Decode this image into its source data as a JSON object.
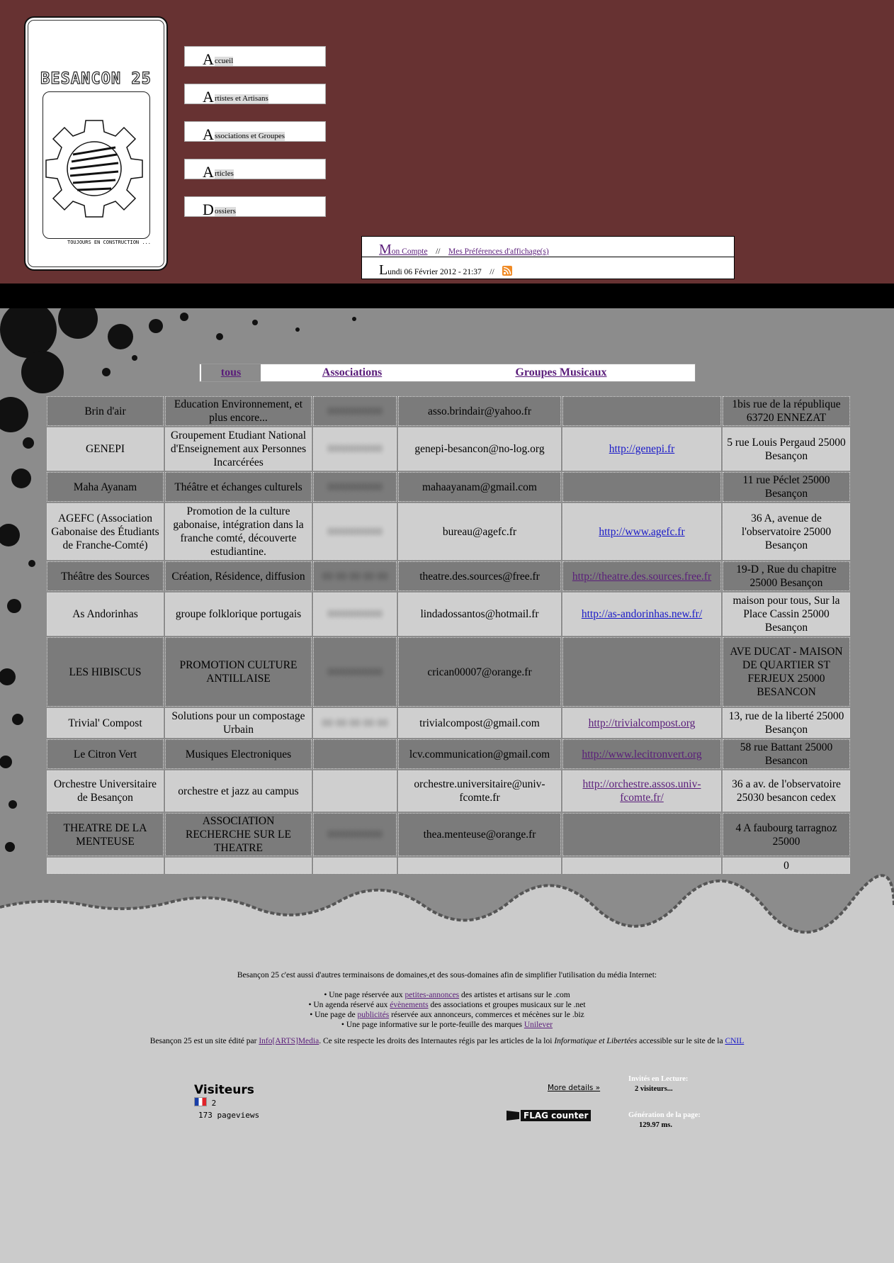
{
  "site": {
    "logo_title": "BESANCON 25",
    "logo_caption": "TOUJOURS EN CONSTRUCTION ..."
  },
  "menu": [
    {
      "initial": "A",
      "rest": "ccueil"
    },
    {
      "initial": "A",
      "rest": "rtistes et Artisans"
    },
    {
      "initial": "A",
      "rest": "ssociations et Groupes"
    },
    {
      "initial": "A",
      "rest": "rticles"
    },
    {
      "initial": "D",
      "rest": "ossiers"
    }
  ],
  "account": {
    "initial": "M",
    "rest": "on Compte",
    "sep": "//",
    "prefs": "Mes Préférences d'affichage(s)"
  },
  "date": {
    "initial": "L",
    "rest": "undi 06 Février 2012 - 21:37",
    "sep": "//"
  },
  "tabs": {
    "all": "tous",
    "assoc": "Associations",
    "music": "Groupes Musicaux"
  },
  "rows": [
    {
      "name": "Brin d'air",
      "desc": "Education Environnement, et plus encore...",
      "phone": "0000000000",
      "email": "asso.brindair@yahoo.fr",
      "site": "",
      "blue": false,
      "addr": "1bis rue de la république 63720 ENNEZAT"
    },
    {
      "name": "GENEPI",
      "desc": "Groupement Etudiant National d'Enseignement aux Personnes Incarcérées",
      "phone": "0000000000",
      "email": "genepi-besancon@no-log.org",
      "site": "http://genepi.fr",
      "blue": true,
      "addr": "5 rue Louis Pergaud 25000 Besançon"
    },
    {
      "name": "Maha Ayanam",
      "desc": "Théâtre et échanges culturels",
      "phone": "0000000000",
      "email": "mahaayanam@gmail.com",
      "site": "",
      "blue": false,
      "addr": "11 rue Péclet 25000 Besançon"
    },
    {
      "name": "AGEFC (Association Gabonaise des Étudiants de Franche-Comté)",
      "desc": "Promotion de la culture gabonaise, intégration dans la franche comté, découverte estudiantine.",
      "phone": "0000000000",
      "email": "bureau@agefc.fr",
      "site": "http://www.agefc.fr",
      "blue": true,
      "addr": "36 A, avenue de l'observatoire 25000 Besançon"
    },
    {
      "name": "Théâtre des Sources",
      "desc": "Création, Résidence, diffusion",
      "phone": "00 00 00 00 00",
      "email": "theatre.des.sources@free.fr",
      "site": "http://theatre.des.sources.free.fr",
      "blue": false,
      "addr": "19-D , Rue du chapitre 25000 Besançon"
    },
    {
      "name": "As Andorinhas",
      "desc": "groupe folklorique portugais",
      "phone": "0000000000",
      "email": "lindadossantos@hotmail.fr",
      "site": "http://as-andorinhas.new.fr/",
      "blue": true,
      "addr": "maison pour tous, Sur la Place Cassin 25000 Besançon"
    },
    {
      "name": "LES HIBISCUS",
      "desc": "PROMOTION CULTURE ANTILLAISE",
      "phone": "0000000000",
      "email": "crican00007@orange.fr",
      "site": "",
      "blue": false,
      "addr": "AVE DUCAT - MAISON DE QUARTIER ST FERJEUX 25000 BESANCON"
    },
    {
      "name": "Trivial' Compost",
      "desc": "Solutions pour un compostage Urbain",
      "phone": "00 00 00 00 00",
      "email": "trivialcompost@gmail.com",
      "site": "http://trivialcompost.org",
      "blue": false,
      "addr": "13, rue de la liberté 25000 Besançon"
    },
    {
      "name": "Le Citron Vert",
      "desc": "Musiques Electroniques",
      "phone": "",
      "email": "lcv.communication@gmail.com",
      "site": "http://www.lecitronvert.org",
      "blue": false,
      "addr": "58 rue Battant 25000 Besancon"
    },
    {
      "name": "Orchestre Universitaire de Besançon",
      "desc": "orchestre et jazz au campus",
      "phone": "",
      "email": "orchestre.universitaire@univ-fcomte.fr",
      "site": "http://orchestre.assos.univ-fcomte.fr/",
      "blue": false,
      "addr": "36 a av. de l'observatoire 25030 besancon cedex"
    },
    {
      "name": "THEATRE DE LA MENTEUSE",
      "desc": "ASSOCIATION RECHERCHE SUR LE THEATRE",
      "phone": "0000000000",
      "email": "thea.menteuse@orange.fr",
      "site": "",
      "blue": false,
      "addr": "4 A faubourg tarragnoz 25000"
    },
    {
      "name": "",
      "desc": "",
      "phone": "",
      "email": "",
      "site": "",
      "blue": false,
      "addr": "0"
    }
  ],
  "footer": {
    "intro": "Besançon 25 c'est aussi d'autres terminaisons de domaines,et des sous-domaines afin de simplifier l'utilisation du média Internet:",
    "items": [
      {
        "pre": "Une page réservée aux ",
        "link": "petites-annonces",
        "post": " des artistes et artisans sur le .com"
      },
      {
        "pre": "Un agenda réservé aux ",
        "link": "évènements",
        "post": " des associations et groupes musicaux sur le .net"
      },
      {
        "pre": "Une page de ",
        "link": "publicités",
        "post": " réservée aux annonceurs, commerces et mécènes sur le .biz"
      },
      {
        "pre": "Une page informative sur le porte-feuille des marques ",
        "link": "Unilever",
        "post": ""
      }
    ],
    "edit_pre": "Besançon 25 est un site édité par ",
    "edit_link": "Info[ARTS]Media",
    "edit_mid": ". Ce site respecte les droits des Internautes régis par les articles de la loi ",
    "edit_law": "Informatique et Libertées",
    "edit_post": " accessible sur le site de la ",
    "edit_cnil": "CNIL"
  },
  "counter": {
    "title": "Visiteurs",
    "count": "2",
    "pageviews": "173 pageviews",
    "more": "More details »",
    "brand": "FLAG counter"
  },
  "stats": {
    "guests_label": "Invités en Lecture:",
    "guests_value": "2 visiteurs...",
    "gen_label": "Génération de la page:",
    "gen_value": "129.97 ms."
  },
  "colors": {
    "header_bg": "#673232",
    "content_bg": "#8c8c8c",
    "footer_bg": "#cbcbcb",
    "link": "#5a1d7a",
    "link_blue": "#1818c8"
  }
}
